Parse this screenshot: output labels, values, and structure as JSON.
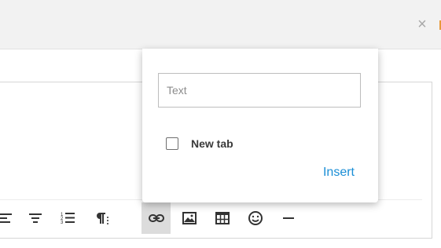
{
  "header": {
    "close_icon": "close-icon"
  },
  "link_popover": {
    "text_placeholder": "Text",
    "new_tab_label": "New tab",
    "new_tab_checked": false,
    "insert_label": "Insert",
    "insert_color": "#1a8ed6"
  },
  "toolbar": {
    "items": [
      {
        "name": "align-left-icon"
      },
      {
        "name": "align-center-icon"
      },
      {
        "name": "ordered-list-icon"
      },
      {
        "name": "paragraph-format-icon"
      },
      {
        "name": "insert-link-icon",
        "active": true
      },
      {
        "name": "insert-image-icon"
      },
      {
        "name": "insert-table-icon"
      },
      {
        "name": "insert-emoji-icon"
      },
      {
        "name": "horizontal-line-icon"
      }
    ]
  }
}
